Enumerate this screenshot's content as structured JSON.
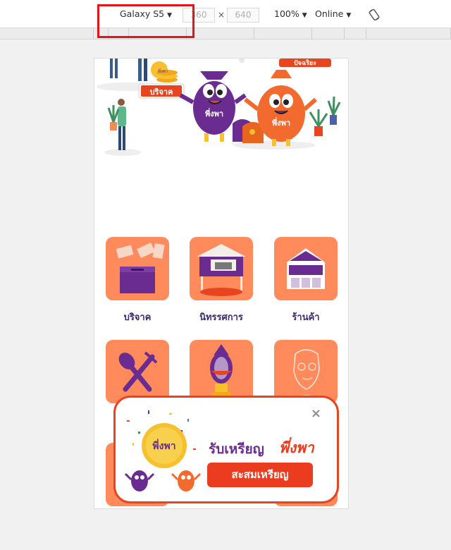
{
  "toolbar": {
    "device": "Galaxy S5",
    "width_value": "360",
    "height_value": "640",
    "dimension_separator": "×",
    "zoom": "100%",
    "network": "Online"
  },
  "hero": {
    "donate_sign": "บริจาค",
    "mascot_belly": "พี่งพา",
    "coin_logo": "พี่งพา",
    "top_sign": "ปัจฉริยะ"
  },
  "menu": {
    "items": [
      {
        "label": "บริจาค",
        "icon": "donation-box-icon"
      },
      {
        "label": "นิทรรศการ",
        "icon": "exhibition-booth-icon"
      },
      {
        "label": "ร้านค้า",
        "icon": "store-icon"
      },
      {
        "label": "",
        "icon": "spoon-fork-icon"
      },
      {
        "label": "",
        "icon": "garland-icon"
      },
      {
        "label": "",
        "icon": "portrait-sketch-icon"
      }
    ]
  },
  "popup": {
    "title": "รับเหรียญ",
    "brand": "พี่งพา",
    "button_label": "สะสมเหรียญ",
    "close_label": "×",
    "coin_text": "พี่งพา"
  },
  "colors": {
    "accent": "#ec3c1f",
    "tile": "#ff8a5b",
    "purple": "#6a2c91",
    "highlight": "#e4141b"
  }
}
